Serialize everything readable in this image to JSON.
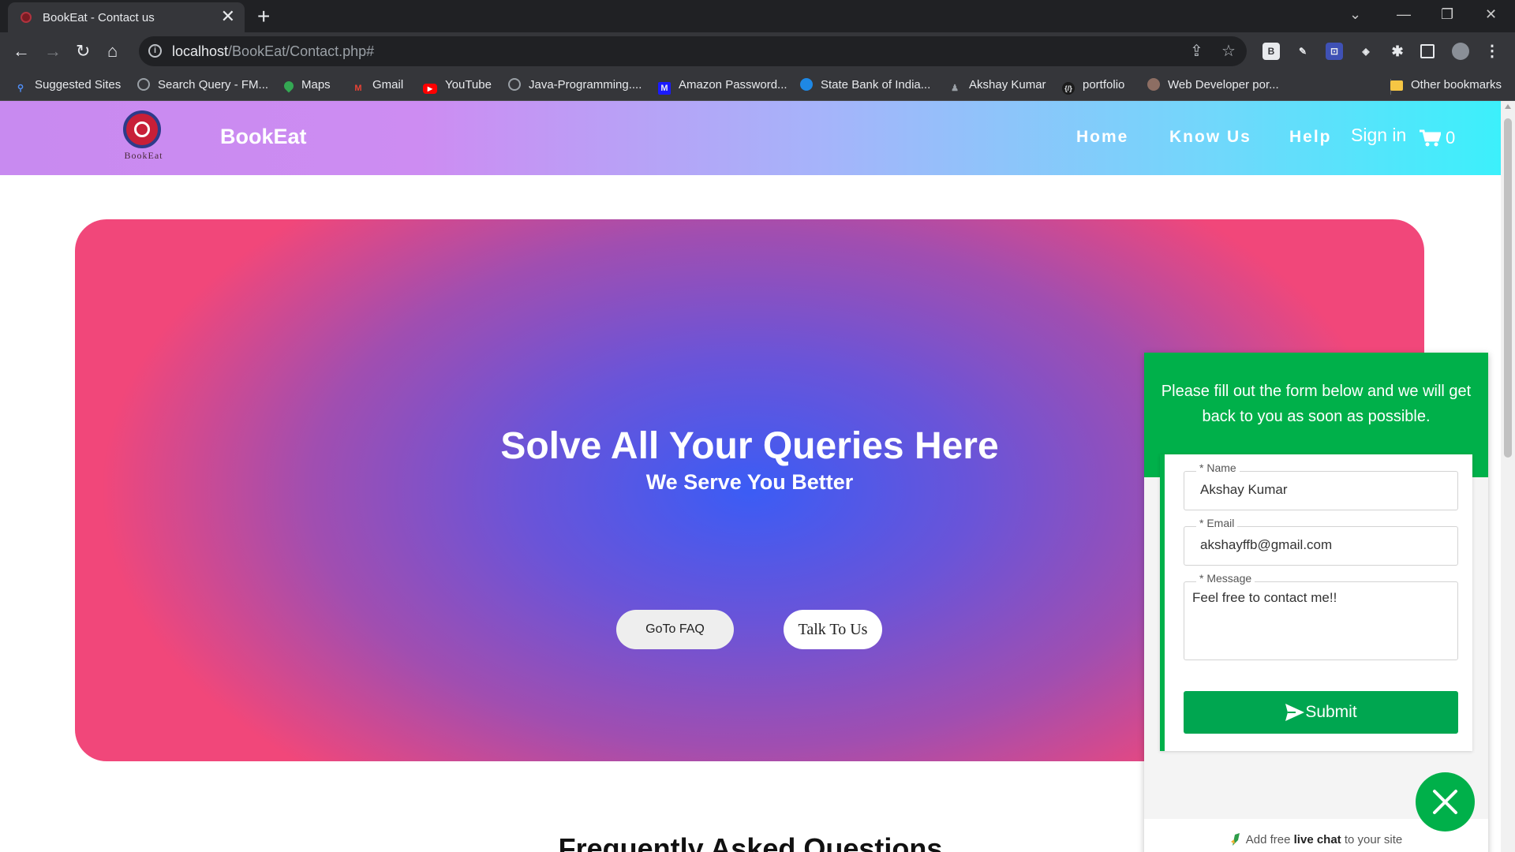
{
  "browser": {
    "tab_title": "BookEat - Contact us",
    "tab_close": "✕",
    "new_tab": "+",
    "url_host": "localhost",
    "url_path": "/BookEat/Contact.php#",
    "bookmarks": [
      {
        "label": "Suggested Sites",
        "icon": "search-icon",
        "color": "#4f8ef7"
      },
      {
        "label": "Search Query - FM...",
        "icon": "globe-icon",
        "color": "#9aa0a6"
      },
      {
        "label": "Maps",
        "icon": "maps-icon",
        "color": "#34a853"
      },
      {
        "label": "Gmail",
        "icon": "gmail-icon",
        "color": "#ea4335"
      },
      {
        "label": "YouTube",
        "icon": "youtube-icon",
        "color": "#ff0000"
      },
      {
        "label": "Java-Programming....",
        "icon": "globe-icon",
        "color": "#9aa0a6"
      },
      {
        "label": "Amazon Password...",
        "icon": "m-icon",
        "color": "#1a1aff"
      },
      {
        "label": "State Bank of India...",
        "icon": "sbi-icon",
        "color": "#1e88e5"
      },
      {
        "label": "Akshay Kumar",
        "icon": "person-icon",
        "color": "#777777"
      },
      {
        "label": "portfolio",
        "icon": "code-icon",
        "color": "#444444"
      },
      {
        "label": "Web Developer por...",
        "icon": "avatar-icon",
        "color": "#8d6e63"
      }
    ],
    "other_bookmarks": "Other bookmarks",
    "extensions": [
      "B",
      "✎",
      "⊡",
      "◈"
    ]
  },
  "site": {
    "logo_text": "BookEat",
    "brand": "BookEat",
    "nav": [
      "Home",
      "Know Us",
      "Help"
    ],
    "signin": "Sign in",
    "cart_count": "0"
  },
  "hero": {
    "title": "Solve All Your Queries Here",
    "subtitle": "We Serve You Better",
    "faq_button": "GoTo FAQ",
    "talk_button": "Talk To Us"
  },
  "faq_heading": "Frequently Asked Questions",
  "widget": {
    "intro": "Please fill out the form below and we will get back to you as soon as possible.",
    "name_label": "* Name",
    "name_value": "Akshay Kumar",
    "email_label": "* Email",
    "email_value": "akshayffb@gmail.com",
    "message_label": "* Message",
    "message_value": "Feel free to contact me!!",
    "submit": "Submit",
    "footer_pre": "Add free ",
    "footer_bold": "live chat",
    "footer_post": " to your site"
  },
  "colors": {
    "accent_green": "#00b04a",
    "hero_center": "#3b5cf5",
    "hero_edge": "#f1477a"
  }
}
